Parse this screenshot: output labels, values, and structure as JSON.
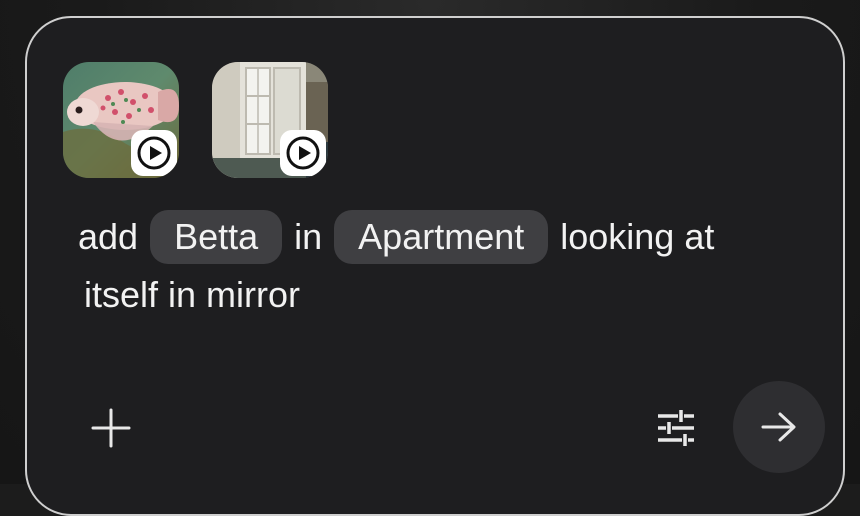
{
  "prompt": {
    "word_add": "add",
    "chip_subject": "Betta",
    "word_in": "in",
    "chip_location": "Apartment",
    "tail_line1": "looking at",
    "tail_line2": "itself in mirror"
  },
  "attachments": [
    {
      "kind": "video",
      "subject": "betta fish",
      "icon": "play-icon"
    },
    {
      "kind": "video",
      "subject": "apartment window",
      "icon": "play-icon"
    }
  ],
  "toolbar": {
    "add_icon": "plus-icon",
    "settings_icon": "tune-icon",
    "send_icon": "arrow-right-icon"
  },
  "colors": {
    "card_bg": "#1e1e20",
    "card_border": "#cfcfcf",
    "chip_bg": "#3f3f42",
    "text": "#f2f2f2",
    "send_bg": "#2e2e31"
  }
}
